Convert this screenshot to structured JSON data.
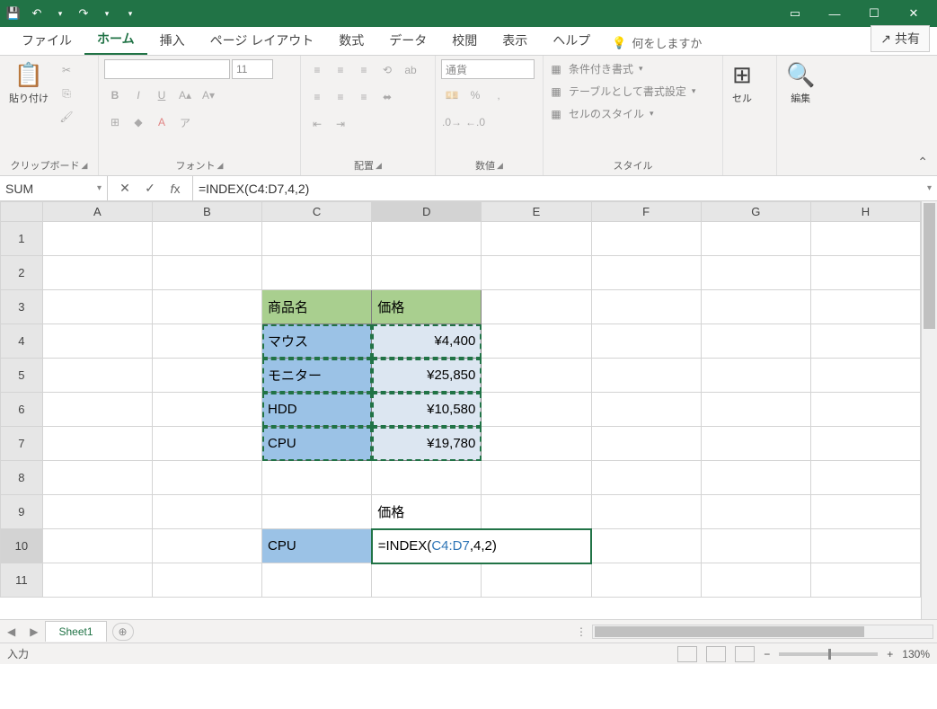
{
  "qat": {
    "save": "💾",
    "undo": "↶",
    "redo": "↷"
  },
  "win": {
    "opts": "▭",
    "min": "—",
    "max": "☐",
    "close": "✕"
  },
  "tabs": {
    "file": "ファイル",
    "home": "ホーム",
    "insert": "挿入",
    "layout": "ページ レイアウト",
    "formulas": "数式",
    "data": "データ",
    "review": "校閲",
    "view": "表示",
    "help": "ヘルプ",
    "tell": "何をしますか",
    "share": "共有"
  },
  "ribbon": {
    "clipboard": {
      "paste": "貼り付け",
      "label": "クリップボード"
    },
    "font": {
      "size": "11",
      "label": "フォント"
    },
    "align": {
      "label": "配置"
    },
    "number": {
      "format": "通貨",
      "label": "数値"
    },
    "styles": {
      "cond": "条件付き書式",
      "table": "テーブルとして書式設定",
      "cell": "セルのスタイル",
      "label": "スタイル"
    },
    "cells": {
      "label": "セル"
    },
    "editing": {
      "label": "編集"
    }
  },
  "namebox": "SUM",
  "formula": "=INDEX(C4:D7,4,2)",
  "formula_parts": {
    "pre": "=INDEX(",
    "range": "C4:D7",
    "post": ",4,2)"
  },
  "cols": [
    "A",
    "B",
    "C",
    "D",
    "E",
    "F",
    "G",
    "H"
  ],
  "rows": [
    "1",
    "2",
    "3",
    "4",
    "5",
    "6",
    "7",
    "8",
    "9",
    "10",
    "11"
  ],
  "cells": {
    "C3": "商品名",
    "D3": "価格",
    "C4": "マウス",
    "D4": "¥4,400",
    "C5": "モニター",
    "D5": "¥25,850",
    "C6": "HDD",
    "D6": "¥10,580",
    "C7": "CPU",
    "D7": "¥19,780",
    "D9": "価格",
    "C10": "CPU"
  },
  "sheet": "Sheet1",
  "status": {
    "mode": "入力",
    "zoom": "130%"
  }
}
